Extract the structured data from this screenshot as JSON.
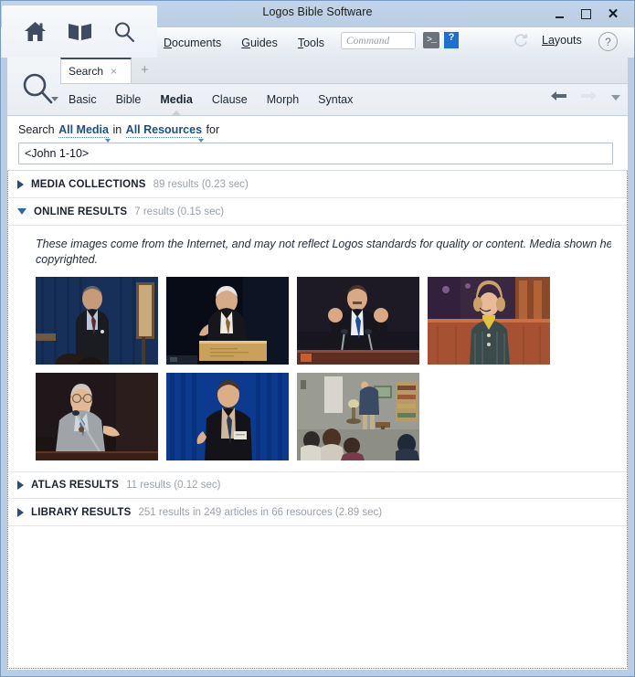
{
  "window": {
    "title": "Logos Bible Software",
    "controls": {
      "minimize": "minimize-button",
      "maximize": "maximize-button",
      "close": "✕"
    }
  },
  "toolbar": {
    "icons": [
      {
        "name": "home-icon",
        "label": "Home"
      },
      {
        "name": "library-book-icon",
        "label": "Library"
      },
      {
        "name": "search-icon",
        "label": "Search"
      }
    ],
    "menus": [
      {
        "label": "Documents",
        "accel": "D"
      },
      {
        "label": "Guides",
        "accel": "G"
      },
      {
        "label": "Tools",
        "accel": "T"
      }
    ],
    "command": {
      "placeholder": "Command",
      "terminal_icon_label": ">_",
      "help_icon_label": "?"
    },
    "refresh_icon": "refresh-icon",
    "layouts_label": "Layouts",
    "layouts_accel": "a",
    "help_icon_label": "?"
  },
  "panel": {
    "icon": "search-magnifier-icon",
    "tab": {
      "label": "Search",
      "close": "×",
      "add": "+"
    },
    "mode_tabs": [
      {
        "label": "Basic",
        "active": false
      },
      {
        "label": "Bible",
        "active": false
      },
      {
        "label": "Media",
        "active": true
      },
      {
        "label": "Clause",
        "active": false
      },
      {
        "label": "Morph",
        "active": false
      },
      {
        "label": "Syntax",
        "active": false
      }
    ],
    "nav": {
      "back": "←",
      "forward": "→",
      "dropdown": "chevron-down-icon"
    }
  },
  "query": {
    "prefix": "Search",
    "scope_media": "All Media",
    "middle": "in",
    "scope_resources": "All Resources",
    "suffix": "for",
    "value": "<John 1-10>",
    "placeholder": ""
  },
  "results": {
    "sections": [
      {
        "id": "media-collections",
        "title": "MEDIA COLLECTIONS",
        "meta": "89 results (0.23 sec)",
        "expanded": false
      },
      {
        "id": "online-results",
        "title": "ONLINE RESULTS",
        "meta": "7 results (0.15 sec)",
        "expanded": true
      },
      {
        "id": "atlas-results",
        "title": "ATLAS RESULTS",
        "meta": "11 results (0.12 sec)",
        "expanded": false
      },
      {
        "id": "library-results",
        "title": "LIBRARY RESULTS",
        "meta": "251 results in 249 articles in 66 resources (2.89 sec)",
        "expanded": false
      }
    ],
    "online": {
      "disclaimer_line1": "These images come from the Internet, and may not reflect Logos standards for quality or content. Media shown here may be",
      "disclaimer_line2": "copyrighted.",
      "thumbnails": [
        {
          "name": "thumbnail-speaker-blue-curtain",
          "alt": "Man in dark suit speaking in front of blue curtain"
        },
        {
          "name": "thumbnail-speaker-podium-dark",
          "alt": "White-haired man gesturing at wooden podium"
        },
        {
          "name": "thumbnail-speaker-raised-fists",
          "alt": "Man at pulpit with raised hands and microphones"
        },
        {
          "name": "thumbnail-woman-headset",
          "alt": "Woman with headset microphone at wooden pulpit"
        },
        {
          "name": "thumbnail-bearded-speaker-mic",
          "alt": "Bearded man with glasses speaking at microphone"
        },
        {
          "name": "thumbnail-speaker-badge-blue",
          "alt": "Man with name badge against blue curtain"
        },
        {
          "name": "thumbnail-room-classroom",
          "alt": "Man teaching in a room with seated audience"
        }
      ]
    }
  },
  "colors": {
    "window_frame": "#b9cde4",
    "link": "#1a4f8a",
    "meta_text": "#9aa2ab",
    "accent_blue": "#1f6fd0"
  }
}
